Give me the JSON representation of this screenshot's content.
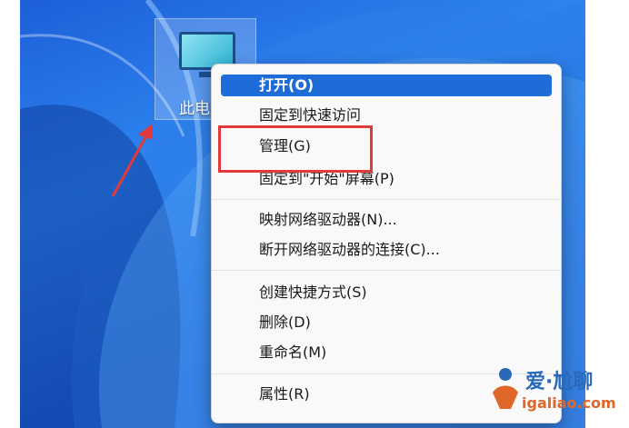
{
  "desktop": {
    "icon_label": "此电脑"
  },
  "context_menu": {
    "items": [
      {
        "label": "打开(O)"
      },
      {
        "label": "固定到快速访问"
      },
      {
        "label": "管理(G)"
      },
      {
        "label": "固定到\"开始\"屏幕(P)"
      },
      {
        "label": "映射网络驱动器(N)..."
      },
      {
        "label": "断开网络驱动器的连接(C)..."
      },
      {
        "label": "创建快捷方式(S)"
      },
      {
        "label": "删除(D)"
      },
      {
        "label": "重命名(M)"
      },
      {
        "label": "属性(R)"
      }
    ]
  },
  "watermark": {
    "title": "爱·尬聊",
    "url": "igaliao.com"
  },
  "colors": {
    "highlight": "#1f6bd8",
    "annotation": "#e23a3a",
    "wallpaper": "#2f86f0"
  }
}
